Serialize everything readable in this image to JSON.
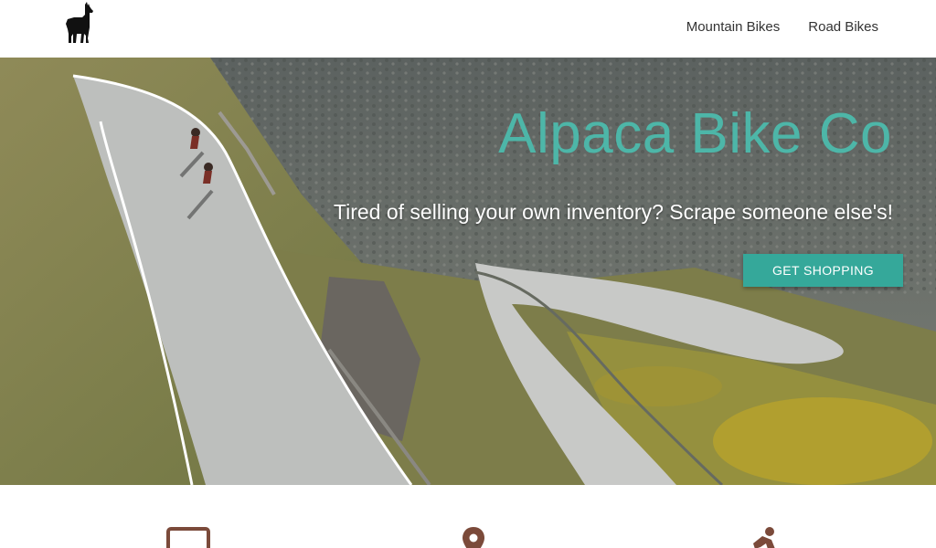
{
  "brand": {
    "logo_icon": "llama-icon"
  },
  "nav": {
    "links": [
      "Mountain Bikes",
      "Road Bikes"
    ]
  },
  "hero": {
    "title": "Alpaca Bike Co",
    "subtitle": "Tired of selling your own inventory? Scrape someone else's!",
    "cta_label": "GET SHOPPING"
  },
  "features": {
    "icons": [
      "laptop-icon",
      "location-pin-icon",
      "person-icon"
    ]
  },
  "colors": {
    "accent": "#35a89a",
    "title": "#4db6a8",
    "icon": "#7b4a3a",
    "nav_text": "#333333"
  }
}
